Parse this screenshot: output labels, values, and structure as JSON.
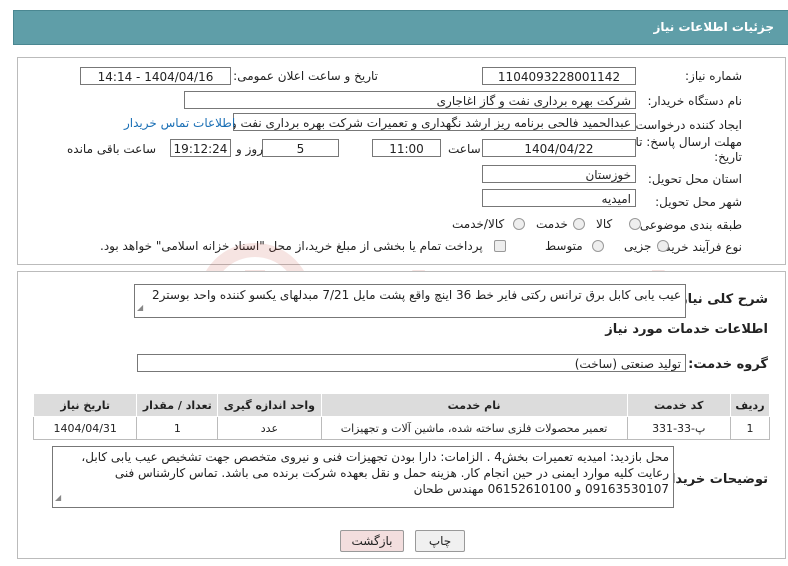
{
  "header": {
    "title": "جزئیات اطلاعات نیاز"
  },
  "fields": {
    "need_number_label": "شماره نیاز:",
    "need_number": "1104093228001142",
    "announce_label": "تاریخ و ساعت اعلان عمومی:",
    "announce_value": "1404/04/16 - 14:14",
    "buyer_label": "نام دستگاه خریدار:",
    "buyer_value": "شرکت بهره برداری نفت و گاز اغاجاری",
    "requester_label": "ایجاد کننده درخواست:",
    "requester_value": "عبدالحمید فالحی برنامه ریز ارشد نگهداری و تعمیرات شرکت بهره برداری نفت و",
    "contact_link": "اطلاعات تماس خریدار",
    "deadline_label_line1": "مهلت ارسال پاسخ: تا",
    "deadline_label_line2": "تاریخ:",
    "deadline_date": "1404/04/22",
    "time_label": "ساعت",
    "deadline_time": "11:00",
    "days_value": "5",
    "days_label": "روز و",
    "remaining_time": "19:12:24",
    "remaining_label": "ساعت باقی مانده",
    "province_label": "استان محل تحویل:",
    "province_value": "خوزستان",
    "city_label": "شهر محل تحویل:",
    "city_value": "امیدیه",
    "category_label": "طبقه بندی موضوعی:",
    "category_options": [
      "کالا",
      "خدمت",
      "کالا/خدمت"
    ],
    "process_label": "نوع فرآیند خرید :",
    "process_options": [
      "جزیی",
      "متوسط"
    ],
    "payment_note": "پرداخت تمام یا بخشی از مبلغ خرید،از محل \"اسناد خزانه اسلامی\" خواهد بود."
  },
  "summary": {
    "label": "شرح کلی نیاز:",
    "text": "عیب یابی کابل برق ترانس رکتی فایر خط 36 اینچ واقع پشت مایل 7/21 مبدلهای یکسو کننده واحد بوستر2"
  },
  "services": {
    "section_title": "اطلاعات خدمات مورد نیاز",
    "group_label": "گروه خدمت:",
    "group_value": "تولید صنعتی (ساخت)",
    "columns": [
      "ردیف",
      "کد خدمت",
      "نام خدمت",
      "واحد اندازه گیری",
      "تعداد / مقدار",
      "تاریخ نیاز"
    ],
    "rows": [
      [
        "1",
        "پ-33-331",
        "تعمیر محصولات فلزی ساخته شده، ماشین آلات و تجهیزات",
        "عدد",
        "1",
        "1404/04/31"
      ]
    ]
  },
  "buyer_notes": {
    "label": "توضیحات خریدار:",
    "text": "محل بازدید: امیدیه تعمیرات بخش4 . الزامات: دارا بودن تجهیزات فنی و نیروی متخصص جهت تشخیص عیب یابی کابل، رعایت کلیه موارد ایمنی در حین انجام کار. هزینه حمل و نقل بعهده شرکت برنده می باشد. تماس کارشناس فنی 09163530107 و 06152610100 مهندس طحان"
  },
  "buttons": {
    "print": "چاپ",
    "back": "بازگشت"
  },
  "colors": {
    "header_bg": "#5f9ea8",
    "link": "#1a6fb5",
    "watermark": "#c0392b"
  }
}
